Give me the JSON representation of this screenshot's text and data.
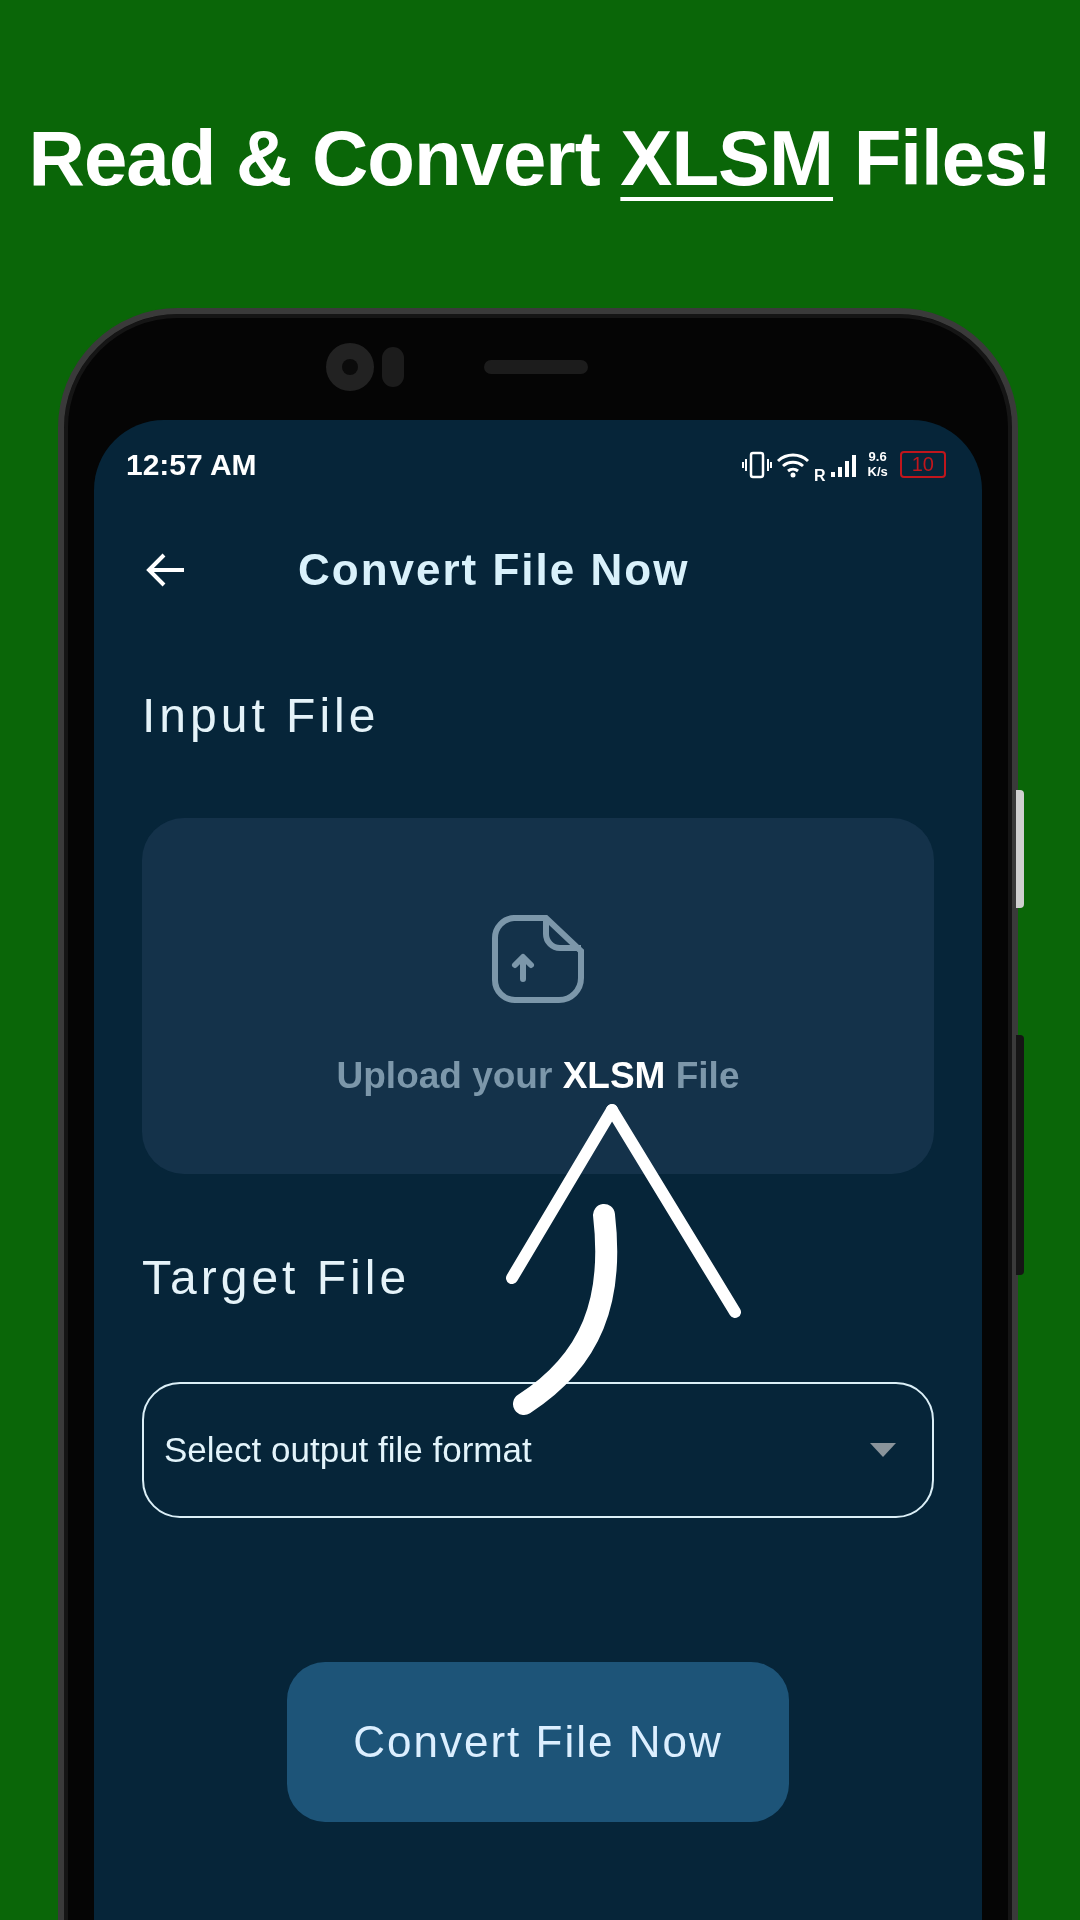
{
  "headline": {
    "before": "Read & Convert ",
    "emphasis": "XLSM",
    "after": " Files!"
  },
  "status_bar": {
    "time": "12:57 AM",
    "network_type": "R",
    "speed_value": "9.6",
    "speed_unit": "K/s",
    "battery": "10",
    "battery_low": true
  },
  "toolbar": {
    "title": "Convert File Now"
  },
  "input_section": {
    "label": "Input File",
    "upload_text": "Upload your **XLSM** File"
  },
  "target_section": {
    "label": "Target File",
    "dropdown": {
      "placeholder": "Select output file format"
    }
  },
  "convert_button": {
    "label": "Convert File Now"
  }
}
